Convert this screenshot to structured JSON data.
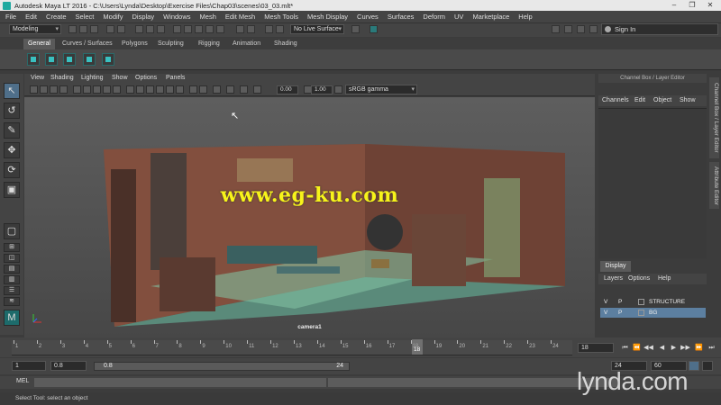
{
  "window": {
    "title": "Autodesk Maya LT 2016 - C:\\Users\\Lynda\\Desktop\\Exercise Files\\Chap03\\scenes\\03_03.mlt*",
    "controls": [
      "–",
      "❐",
      "✕"
    ]
  },
  "menubar": [
    "File",
    "Edit",
    "Create",
    "Select",
    "Modify",
    "Display",
    "Windows",
    "Mesh",
    "Edit Mesh",
    "Mesh Tools",
    "Mesh Display",
    "Curves",
    "Surfaces",
    "Deform",
    "UV",
    "Marketplace",
    "Help"
  ],
  "statusline": {
    "mode": "Modeling",
    "live_surface": "No Live Surface",
    "sign_in": "Sign In"
  },
  "shelf": {
    "tabs": [
      "General",
      "Curves / Surfaces",
      "Polygons",
      "Sculpting",
      "Rigging",
      "Animation",
      "Shading"
    ],
    "active_tab": "General"
  },
  "viewport": {
    "menus": [
      "View",
      "Shading",
      "Lighting",
      "Show",
      "Options",
      "Panels"
    ],
    "exposure": "0.00",
    "gamma": "1.00",
    "color_space": "sRGB gamma",
    "camera": "camera1",
    "watermark": "www.eg-ku.com"
  },
  "channel_box": {
    "header": "Channel Box / Layer Editor",
    "menus": [
      "Channels",
      "Edit",
      "Object",
      "Show"
    ],
    "side_tabs": [
      "Channel Box / Layer Editor",
      "Attribute Editor"
    ]
  },
  "layer_editor": {
    "tab": "Display",
    "menus": [
      "Layers",
      "Options",
      "Help"
    ],
    "layers": [
      {
        "v": "V",
        "p": "P",
        "name": "STRUCTURE",
        "selected": false
      },
      {
        "v": "V",
        "p": "P",
        "name": "BG",
        "selected": true
      }
    ]
  },
  "timeslider": {
    "ticks": [
      "1",
      "2",
      "3",
      "4",
      "5",
      "6",
      "7",
      "8",
      "9",
      "10",
      "11",
      "12",
      "13",
      "14",
      "15",
      "16",
      "17",
      "18",
      "19",
      "20",
      "21",
      "22",
      "23",
      "24"
    ],
    "current_frame": "18",
    "frame_field": "18",
    "playback": [
      "⏮",
      "⏪",
      "◀◀",
      "◀",
      "▶",
      "▶▶",
      "⏩",
      "⏭"
    ]
  },
  "range": {
    "start": "1",
    "anim_start": "0.8",
    "slider_start": "0.8",
    "slider_end": "24",
    "anim_end": "24",
    "end": "60"
  },
  "cmdline": {
    "label": "MEL"
  },
  "helpline": "Select Tool: select an object",
  "brand": "lynda.com",
  "colors": {
    "accent": "#39c0c0",
    "watermark": "#f7f31a",
    "selected_layer": "#5c7fa0"
  }
}
